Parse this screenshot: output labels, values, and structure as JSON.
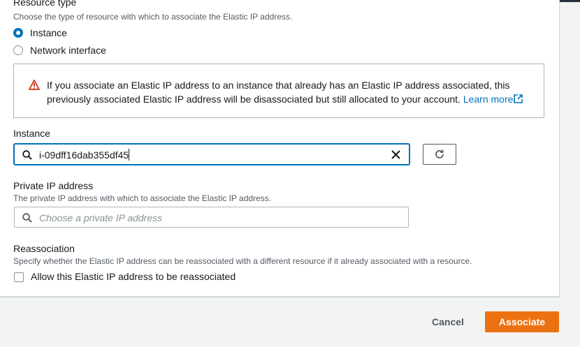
{
  "resource_type": {
    "heading": "Resource type",
    "description": "Choose the type of resource with which to associate the Elastic IP address.",
    "options": [
      {
        "label": "Instance",
        "selected": true
      },
      {
        "label": "Network interface",
        "selected": false
      }
    ]
  },
  "alert": {
    "icon": "warning-icon",
    "line1": "If you associate an Elastic IP address to an instance that already has an Elastic IP address associated, this",
    "line2": "previously associated Elastic IP address will be disassociated but still allocated to your account.",
    "link_text": "Learn more"
  },
  "instance": {
    "label": "Instance",
    "value": "i-09dff16dab355df45"
  },
  "private_ip": {
    "label": "Private IP address",
    "description": "The private IP address with which to associate the Elastic IP address.",
    "placeholder": "Choose a private IP address"
  },
  "reassociation": {
    "label": "Reassociation",
    "description": "Specify whether the Elastic IP address can be reassociated with a different resource if it already associated with a resource.",
    "checkbox_label": "Allow this Elastic IP address to be reassociated",
    "checked": false
  },
  "footer": {
    "cancel_label": "Cancel",
    "associate_label": "Associate"
  },
  "colors": {
    "accent": "#0073bb",
    "primary_button": "#ec7211",
    "warning": "#d13212"
  }
}
